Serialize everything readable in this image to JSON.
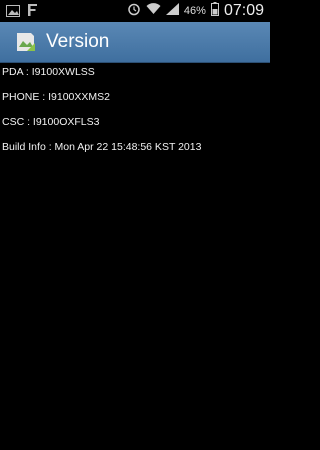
{
  "status_bar": {
    "left_icons": [
      "gallery-icon",
      "f-icon"
    ],
    "right_icons": [
      "alarm-icon",
      "wifi-icon",
      "signal-icon"
    ],
    "battery_percent": "46%",
    "time": "07:09"
  },
  "title_bar": {
    "icon": "app-icon",
    "title": "Version"
  },
  "info": {
    "pda": "PDA : I9100XWLSS",
    "phone": "PHONE : I9100XXMS2",
    "csc": "CSC : I9100OXFLS3",
    "build": "Build Info : Mon Apr 22 15:48:56 KST 2013"
  },
  "colors": {
    "title_bar": "#4f7ea8",
    "background": "#000000"
  }
}
